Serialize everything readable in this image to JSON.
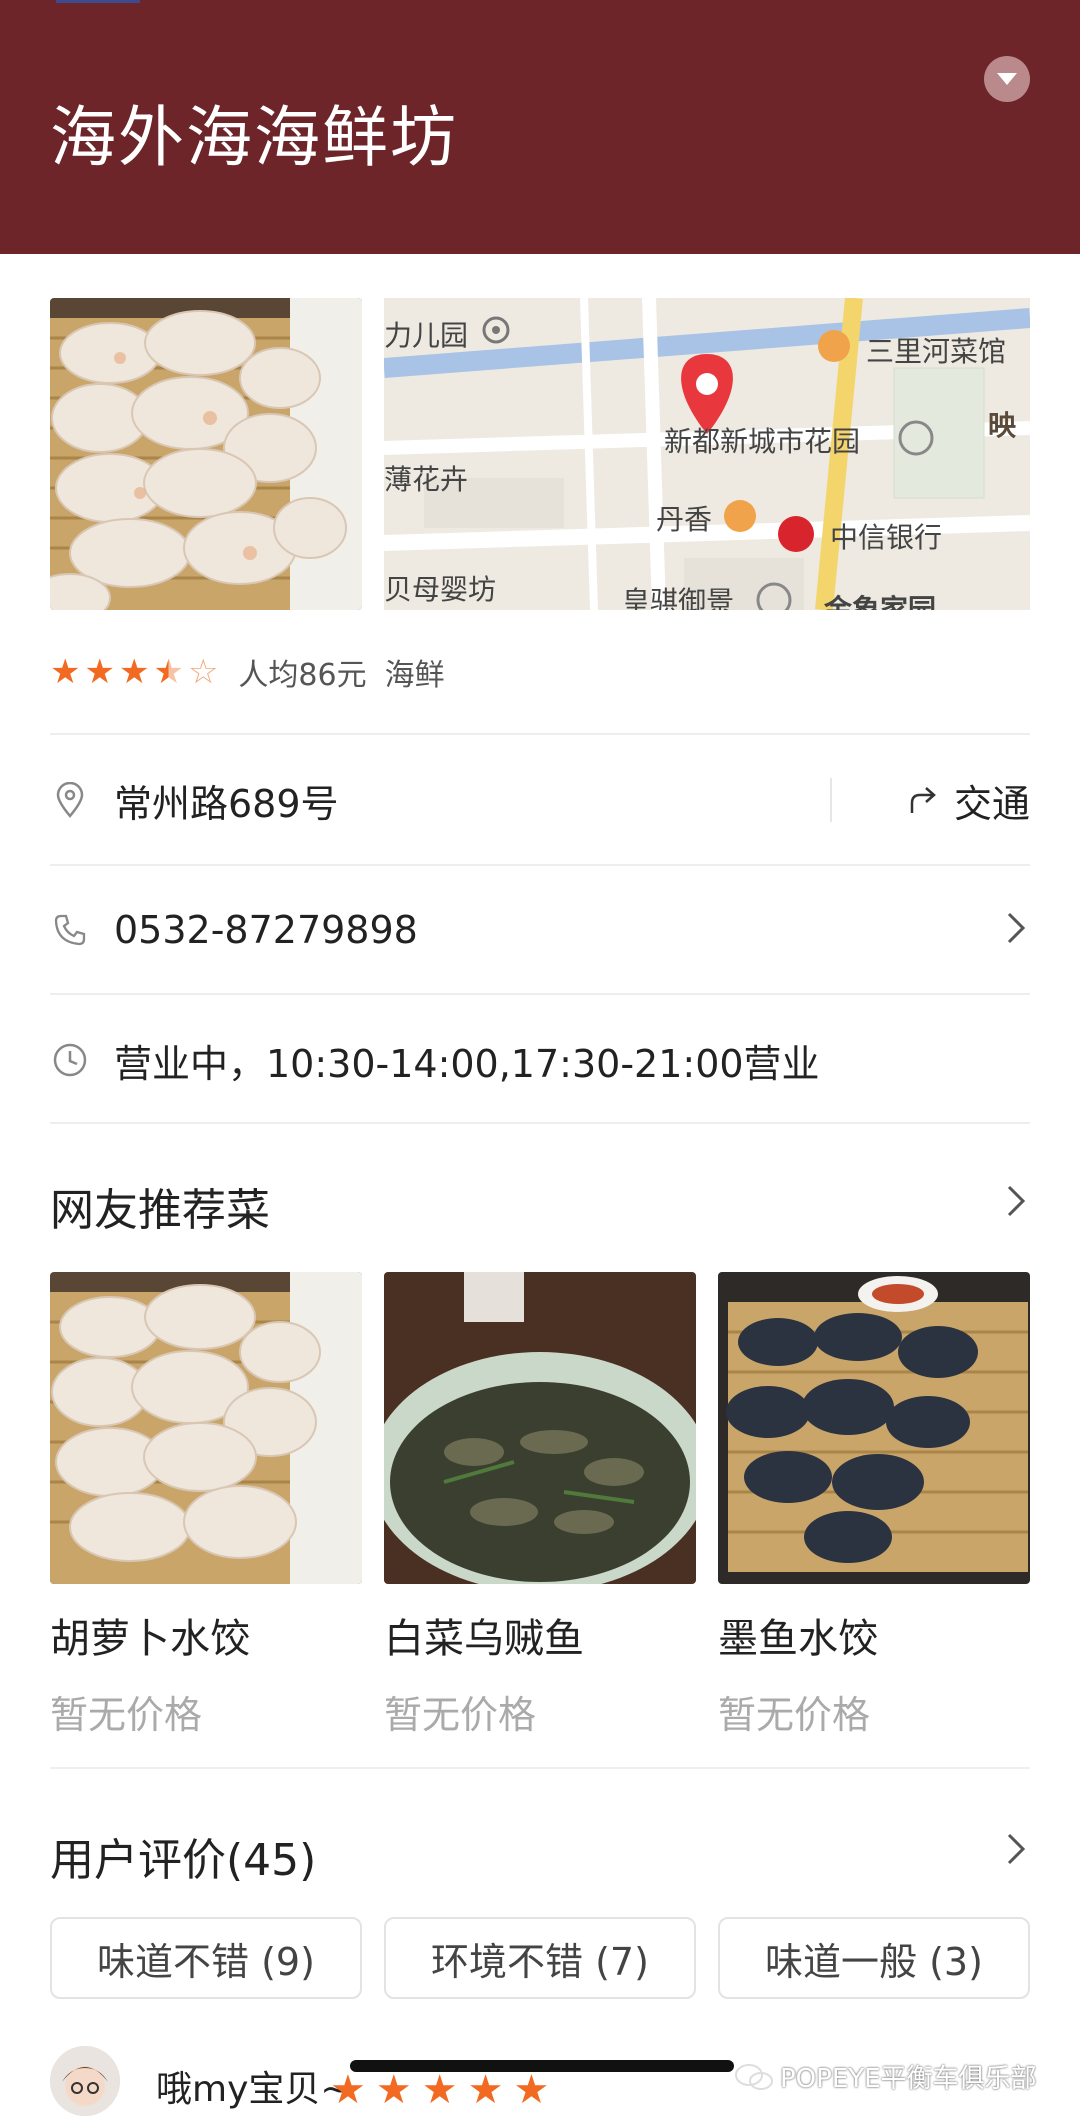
{
  "header": {
    "title": "海外海海鲜坊"
  },
  "map": {
    "labels": [
      "力儿园",
      "三里河菜馆",
      "新都新城市花园",
      "映",
      "薄花卉",
      "丹香",
      "中信银行",
      "贝母婴坊",
      "皇骐御景",
      "金象家园"
    ]
  },
  "rating": {
    "stars": 3.5,
    "avg_price": "人均86元",
    "category": "海鲜"
  },
  "info": {
    "address": "常州路689号",
    "traffic_label": "交通",
    "phone": "0532-87279898",
    "hours": "营业中，10:30-14:00,17:30-21:00营业"
  },
  "recommended": {
    "title": "网友推荐菜",
    "dishes": [
      {
        "name": "胡萝卜水饺",
        "price": "暂无价格"
      },
      {
        "name": "白菜乌贼鱼",
        "price": "暂无价格"
      },
      {
        "name": "墨鱼水饺",
        "price": "暂无价格"
      }
    ]
  },
  "reviews": {
    "title": "用户评价(45)",
    "tags": [
      "味道不错 (9)",
      "环境不错 (7)",
      "味道一般 (3)"
    ],
    "first_user": "哦my宝贝~",
    "first_stars": 5
  },
  "watermark": "POPEYE平衡车俱乐部",
  "colors": {
    "header_bg": "#6d2529",
    "star": "#f26a21",
    "map_pin": "#e8383d"
  }
}
